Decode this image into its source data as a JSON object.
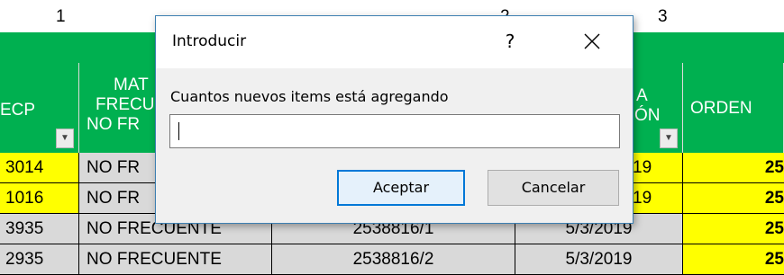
{
  "sheet": {
    "col_numbers": [
      "1",
      "2",
      "3"
    ],
    "headers": {
      "h1": "ECP",
      "h2_line1": "MAT",
      "h2_line2": "FRECU",
      "h2_line3": "NO FR",
      "h4_line1": "A",
      "h4_line2": "ÓN",
      "h5": "ORDEN"
    },
    "rows": [
      {
        "c1": "3014",
        "c2": "NO FR",
        "c3": "",
        "c4": "19",
        "c5": "25"
      },
      {
        "c1": "1016",
        "c2": "NO FR",
        "c3": "",
        "c4": "19",
        "c5": "25"
      },
      {
        "c1": "3935",
        "c2": "NO FRECUENTE",
        "c3": "2538816/1",
        "c4": "5/3/2019",
        "c5": "25"
      },
      {
        "c1": "2935",
        "c2": "NO FRECUENTE",
        "c3": "2538816/2",
        "c4": "5/3/2019",
        "c5": "25"
      }
    ],
    "colors": {
      "green": "#00b050",
      "yellow": "#ffff00",
      "gray": "#d9d9d9"
    }
  },
  "dialog": {
    "title": "Introducir",
    "help_label": "?",
    "close_icon": "close-icon",
    "prompt": "Cuantos nuevos items está agregando",
    "input_value": "",
    "ok_label": "Aceptar",
    "cancel_label": "Cancelar",
    "accent": "#0078d7"
  }
}
